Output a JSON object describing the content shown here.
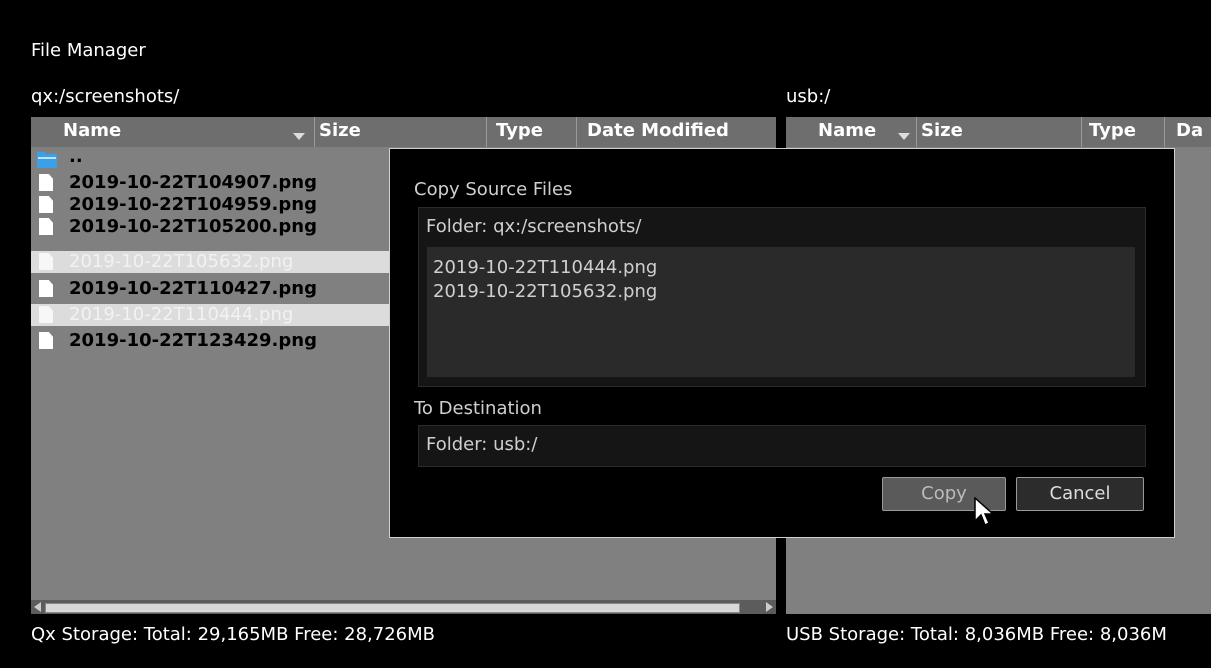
{
  "app": {
    "title": "File Manager"
  },
  "left": {
    "path": "qx:/screenshots/",
    "columns": {
      "name": "Name",
      "size": "Size",
      "type": "Type",
      "date": "Date Modified"
    },
    "parent": "..",
    "files": [
      {
        "name": "2019-10-22T104907.png",
        "selected": false
      },
      {
        "name": "2019-10-22T104959.png",
        "selected": false
      },
      {
        "name": "2019-10-22T105200.png",
        "selected": false
      },
      {
        "name": "2019-10-22T105632.png",
        "selected": true
      },
      {
        "name": "2019-10-22T110427.png",
        "selected": false
      },
      {
        "name": "2019-10-22T110444.png",
        "selected": true
      },
      {
        "name": "2019-10-22T123429.png",
        "selected": false
      }
    ],
    "status": "Qx Storage: Total: 29,165MB Free: 28,726MB"
  },
  "right": {
    "path": "usb:/",
    "columns": {
      "name": "Name",
      "size": "Size",
      "type": "Type",
      "date": "Da"
    },
    "status": "USB Storage: Total: 8,036MB Free: 8,036M"
  },
  "dialog": {
    "source_label": "Copy Source Files",
    "source_folder": "Folder: qx:/screenshots/",
    "source_files": [
      "2019-10-22T110444.png",
      "2019-10-22T105632.png"
    ],
    "dest_label": "To Destination",
    "dest_folder": "Folder: usb:/",
    "copy_label": "Copy",
    "cancel_label": "Cancel"
  },
  "icons": {
    "sort": "sort-down-icon",
    "folder": "folder-icon",
    "file": "file-icon",
    "cursor": "mouse-pointer-icon"
  },
  "colors": {
    "panel": "#808080",
    "header": "#6e6e6e",
    "selection": "#dcdcdc",
    "folder": "#3aa0e8"
  }
}
